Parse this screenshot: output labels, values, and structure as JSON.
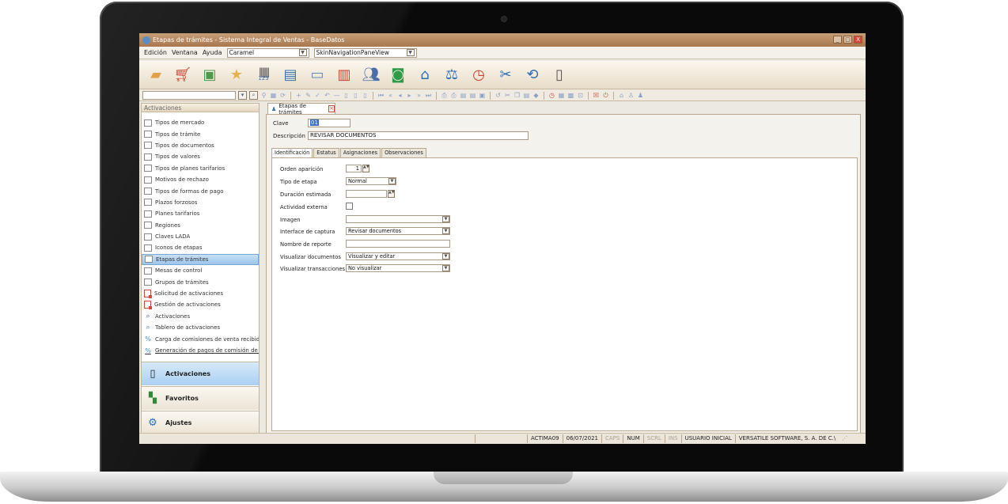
{
  "window": {
    "title": "Etapas de trámites - Sistema Integral de Ventas - BaseDatos",
    "minimize": "_",
    "maximize": "□",
    "close": "X"
  },
  "menu": {
    "items": [
      "Edición",
      "Ventana",
      "Ayuda"
    ],
    "skin_value": "Caramel",
    "view_value": "SkinNavigationPaneView"
  },
  "toolbar_big": [
    "folder-icon",
    "cart-icon",
    "window-check-icon",
    "folder-star-icon",
    "barcode-icon",
    "document-icon",
    "id-card-icon",
    "chart-doc-icon",
    "users-icon",
    "money-icon",
    "bank-icon",
    "scales-icon",
    "clock-icon",
    "tools-icon",
    "refresh-icon",
    "phone-icon"
  ],
  "barcode_digits": "123",
  "search": {
    "placeholder": ""
  },
  "nav": {
    "header": "Activaciones",
    "items": [
      {
        "label": "Tipos de mercado",
        "icon": "box"
      },
      {
        "label": "Tipos de trámite",
        "icon": "box"
      },
      {
        "label": "Tipos de documentos",
        "icon": "box"
      },
      {
        "label": "Tipos de valores",
        "icon": "box"
      },
      {
        "label": "Tipos de planes tarifarios",
        "icon": "box"
      },
      {
        "label": "Motivos de rechazo",
        "icon": "box"
      },
      {
        "label": "Tipos de formas de pago",
        "icon": "box"
      },
      {
        "label": "Plazos forzosos",
        "icon": "box"
      },
      {
        "label": "Planes tarifarios",
        "icon": "box"
      },
      {
        "label": "Regiones",
        "icon": "box"
      },
      {
        "label": "Claves LADA",
        "icon": "box"
      },
      {
        "label": "Iconos de etapas",
        "icon": "box"
      },
      {
        "label": "Etapas de trámites",
        "icon": "box"
      },
      {
        "label": "Mesas de control",
        "icon": "box"
      },
      {
        "label": "Grupos de trámites",
        "icon": "box"
      },
      {
        "label": "Solicitud de activaciones",
        "icon": "doc-red"
      },
      {
        "label": "Gestión de activaciones",
        "icon": "doc-red"
      },
      {
        "label": "Activaciones",
        "icon": "mag"
      },
      {
        "label": "Tablero de activaciones",
        "icon": "mag"
      },
      {
        "label": "Carga de comisiones de venta recibidas",
        "icon": "pct"
      },
      {
        "label": "Generación de pagos de comisión de v...",
        "icon": "pct"
      }
    ],
    "groups": [
      "Activaciones",
      "Favoritos",
      "Ajustes"
    ]
  },
  "doc": {
    "tab_label": "Etapas de trámites",
    "clave_label": "Clave",
    "clave_value": "01",
    "descripcion_label": "Descripción",
    "descripcion_value": "REVISAR DOCUMENTOS",
    "tabs": [
      "Identificación",
      "Estatus",
      "Asignaciones",
      "Observaciones"
    ],
    "form": {
      "orden_label": "Orden aparición",
      "orden_value": "1",
      "tipo_label": "Tipo de etapa",
      "tipo_value": "Normal",
      "duracion_label": "Duración estimada",
      "duracion_value": "",
      "actividad_label": "Actividad externa",
      "imagen_label": "Imagen",
      "imagen_value": "",
      "interface_label": "Interface de captura",
      "interface_value": "Revisar documentos",
      "reporte_label": "Nombre de reporte",
      "reporte_value": "",
      "vis_docs_label": "Visualizar documentos",
      "vis_docs_value": "Visualizar y editar",
      "vis_trans_label": "Visualizar transacciones",
      "vis_trans_value": "No visualizar"
    }
  },
  "status": {
    "machine": "ACTIMA09",
    "date": "06/07/2021",
    "caps": "CAPS",
    "num": "NUM",
    "scrl": "SCRL",
    "ins": "INS",
    "user": "USUARIO INICIAL",
    "company": "VERSATILE SOFTWARE, S. A. DE C.\\"
  },
  "colors": {
    "titlebar": "#b38a62",
    "selection": "#9cc5ea",
    "accent_red": "#d04a3a"
  }
}
